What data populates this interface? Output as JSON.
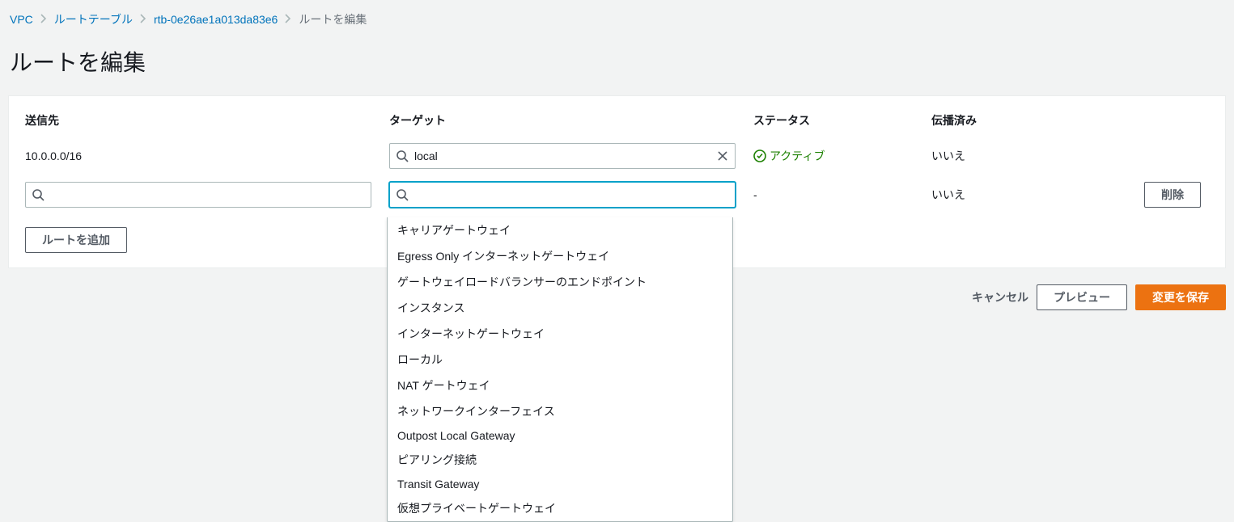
{
  "breadcrumb": {
    "items": [
      "VPC",
      "ルートテーブル",
      "rtb-0e26ae1a013da83e6"
    ],
    "current": "ルートを編集"
  },
  "page_title": "ルートを編集",
  "table": {
    "headers": {
      "destination": "送信先",
      "target": "ターゲット",
      "status": "ステータス",
      "propagated": "伝播済み"
    },
    "rows": [
      {
        "destination": "10.0.0.0/16",
        "target_value": "local",
        "status_label": "アクティブ",
        "propagated": "いいえ"
      },
      {
        "destination": "",
        "target_value": "",
        "status_label": "-",
        "propagated": "いいえ"
      }
    ]
  },
  "buttons": {
    "delete": "削除",
    "add_route": "ルートを追加",
    "cancel": "キャンセル",
    "preview": "プレビュー",
    "save": "変更を保存"
  },
  "dropdown_options": [
    "キャリアゲートウェイ",
    "Egress Only インターネットゲートウェイ",
    "ゲートウェイロードバランサーのエンドポイント",
    "インスタンス",
    "インターネットゲートウェイ",
    "ローカル",
    "NAT ゲートウェイ",
    "ネットワークインターフェイス",
    "Outpost Local Gateway",
    "ピアリング接続",
    "Transit Gateway",
    "仮想プライベートゲートウェイ"
  ]
}
